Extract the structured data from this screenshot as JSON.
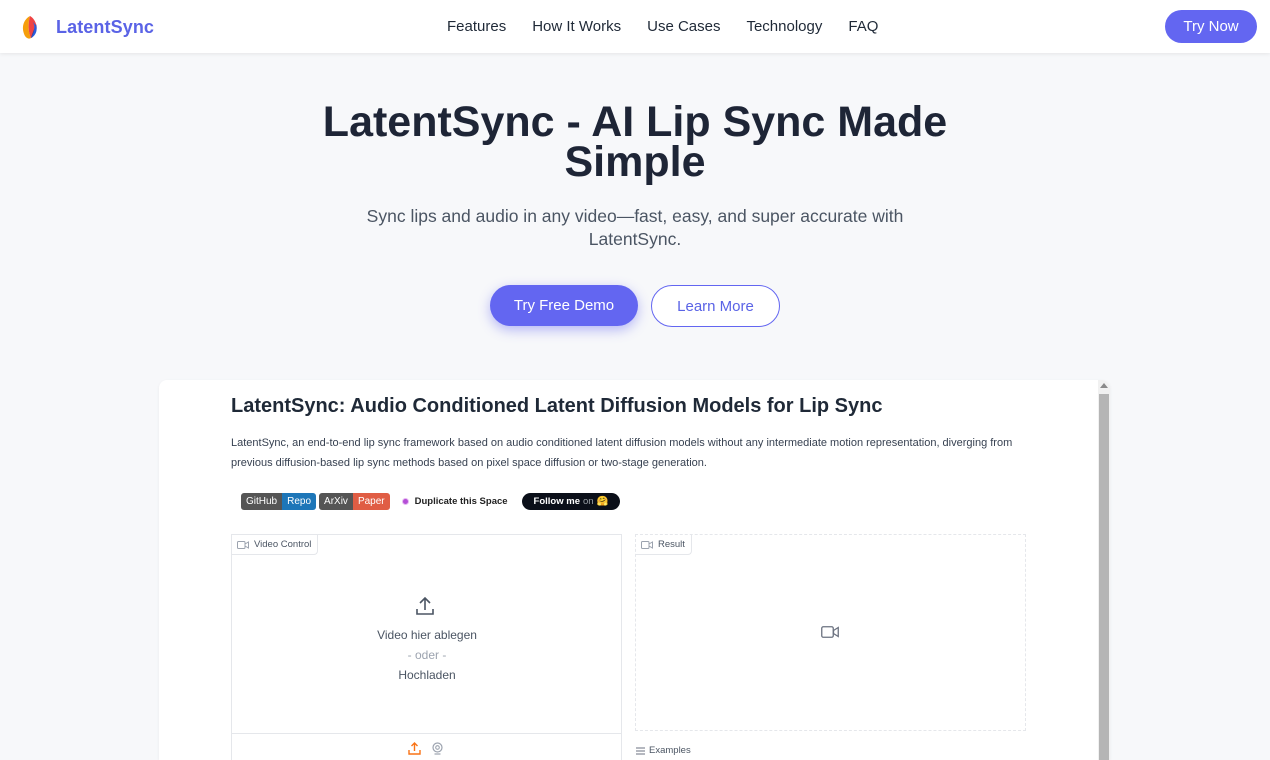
{
  "header": {
    "brand_name": "LatentSync",
    "nav": [
      "Features",
      "How It Works",
      "Use Cases",
      "Technology",
      "FAQ"
    ],
    "cta_label": "Try Now"
  },
  "hero": {
    "title_line1": "LatentSync - AI Lip Sync Made",
    "title_line2": "Simple",
    "subtitle_line1": "Sync lips and audio in any video—fast, easy, and super accurate with",
    "subtitle_line2": "LatentSync.",
    "primary_button": "Try Free Demo",
    "secondary_button": "Learn More"
  },
  "app": {
    "title": "LatentSync: Audio Conditioned Latent Diffusion Models for Lip Sync",
    "desc_line1": "LatentSync, an end-to-end lip sync framework based on audio conditioned latent diffusion models without any intermediate motion representation, diverging from",
    "desc_line2": "previous diffusion-based lip sync methods based on pixel space diffusion or two-stage generation.",
    "badges": {
      "github_left": "GitHub",
      "github_right": "Repo",
      "arxiv_left": "ArXiv",
      "arxiv_right": "Paper",
      "duplicate": "Duplicate this Space",
      "follow": "Follow me",
      "follow_on": "on",
      "follow_emoji": "🤗"
    },
    "video_panel": {
      "label": "Video Control",
      "drop_text": "Video hier ablegen",
      "or_text": "- oder -",
      "upload_text": "Hochladen"
    },
    "result_panel": {
      "label": "Result"
    },
    "examples_label": "Examples"
  },
  "colors": {
    "accent": "#6366f1",
    "brand_text": "#5a63e6",
    "github_badge": "#1d76b8",
    "arxiv_badge": "#e05d44"
  }
}
